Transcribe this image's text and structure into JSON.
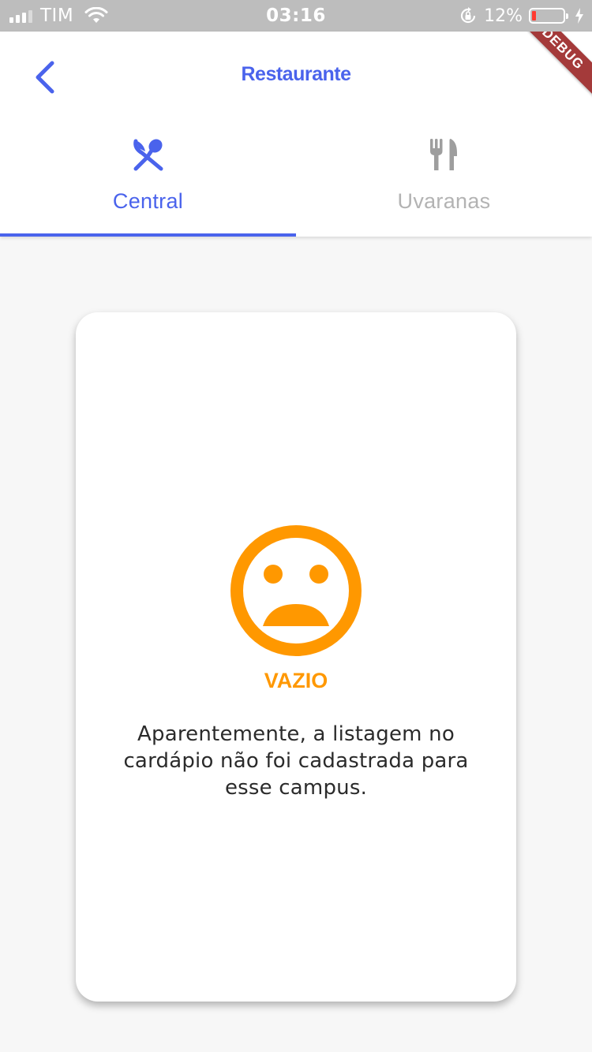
{
  "status_bar": {
    "carrier": "TIM",
    "time": "03:16",
    "battery_percent": "12%",
    "battery_level": 0.12,
    "battery_color": "#ff3b30",
    "icons": [
      "signal-icon",
      "wifi-icon",
      "orientation-lock-icon",
      "battery-icon",
      "charging-icon"
    ]
  },
  "header": {
    "title": "Restaurante",
    "back_icon": "chevron-left-icon",
    "debug_banner": "DEBUG"
  },
  "tabs": [
    {
      "label": "Central",
      "icon": "spoon-knife-crossed-icon",
      "selected": true
    },
    {
      "label": "Uvaranas",
      "icon": "fork-knife-icon",
      "selected": false
    }
  ],
  "empty_state": {
    "icon": "sad-face-icon",
    "title": "VAZIO",
    "message": "Aparentemente, a listagem no cardápio não foi cadastrada para esse campus."
  },
  "colors": {
    "accent": "#4a63ec",
    "warning": "#ff9800",
    "inactive": "#b3b3b3",
    "background": "#f7f7f7",
    "debug_banner": "#a43a3a"
  }
}
